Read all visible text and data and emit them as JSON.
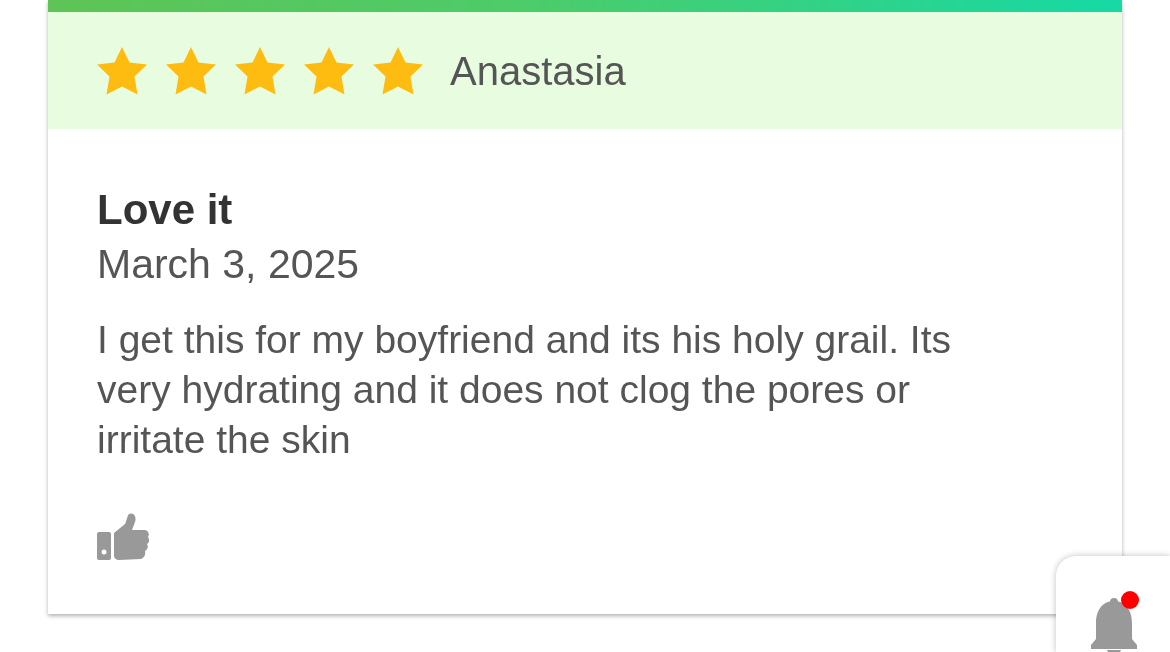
{
  "review": {
    "stars": 5,
    "author": "Anastasia",
    "title": "Love it",
    "date": "March 3, 2025",
    "body": "I get this for my boyfriend and its his holy grail. Its very hydrating and it does not clog the pores or irritate the skin"
  },
  "notification": {
    "unread": true
  }
}
